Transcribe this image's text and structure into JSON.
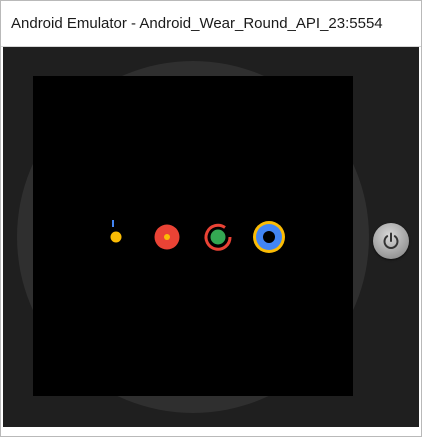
{
  "window": {
    "title": "Android Emulator - Android_Wear_Round_API_23:5554"
  },
  "colors": {
    "title_bar": "#ffffff",
    "emulator_bg": "#1f1f1f",
    "bezel": "#2f2f2f",
    "screen": "#000000",
    "google_blue": "#4285f4",
    "google_red": "#ea4335",
    "google_yellow": "#fbbc05",
    "google_green": "#34a853"
  },
  "icons": {
    "power": "power-icon"
  }
}
